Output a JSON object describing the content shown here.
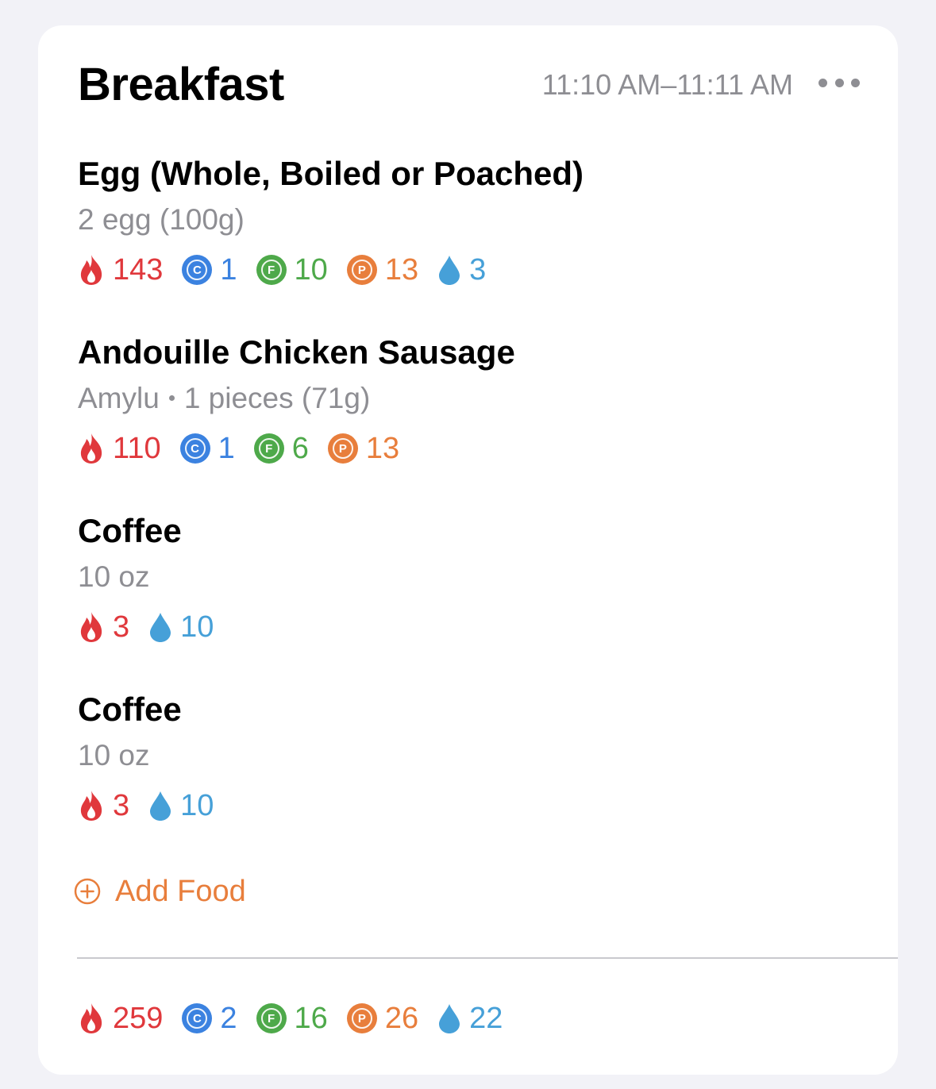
{
  "meal": {
    "title": "Breakfast",
    "time_range": "11:10 AM–11:11 AM",
    "more_icon": "ellipsis-icon"
  },
  "items": [
    {
      "name": "Egg (Whole, Boiled or Poached)",
      "brand": "",
      "serving": "2 egg (100g)",
      "calories": "143",
      "carbs": "1",
      "fat": "10",
      "protein": "13",
      "water": "3"
    },
    {
      "name": "Andouille Chicken Sausage",
      "brand": "Amylu",
      "serving": "1 pieces (71g)",
      "calories": "110",
      "carbs": "1",
      "fat": "6",
      "protein": "13",
      "water": ""
    },
    {
      "name": "Coffee",
      "brand": "",
      "serving": "10 oz",
      "calories": "3",
      "carbs": "",
      "fat": "",
      "protein": "",
      "water": "10"
    },
    {
      "name": "Coffee",
      "brand": "",
      "serving": "10 oz",
      "calories": "3",
      "carbs": "",
      "fat": "",
      "protein": "",
      "water": "10"
    }
  ],
  "add_food": {
    "label": "Add Food",
    "icon": "plus-circle-icon"
  },
  "totals": {
    "calories": "259",
    "carbs": "2",
    "fat": "16",
    "protein": "26",
    "water": "22"
  },
  "badges": {
    "carbs": "C",
    "fat": "F",
    "protein": "P"
  },
  "colors": {
    "calories": "#e0383c",
    "carbs": "#3b82e0",
    "fat": "#4ea94a",
    "protein": "#e87e3c",
    "water": "#46a0d8",
    "accent": "#e87e3c",
    "secondary_text": "#8e8e93",
    "background": "#f2f2f7",
    "card": "#ffffff"
  }
}
